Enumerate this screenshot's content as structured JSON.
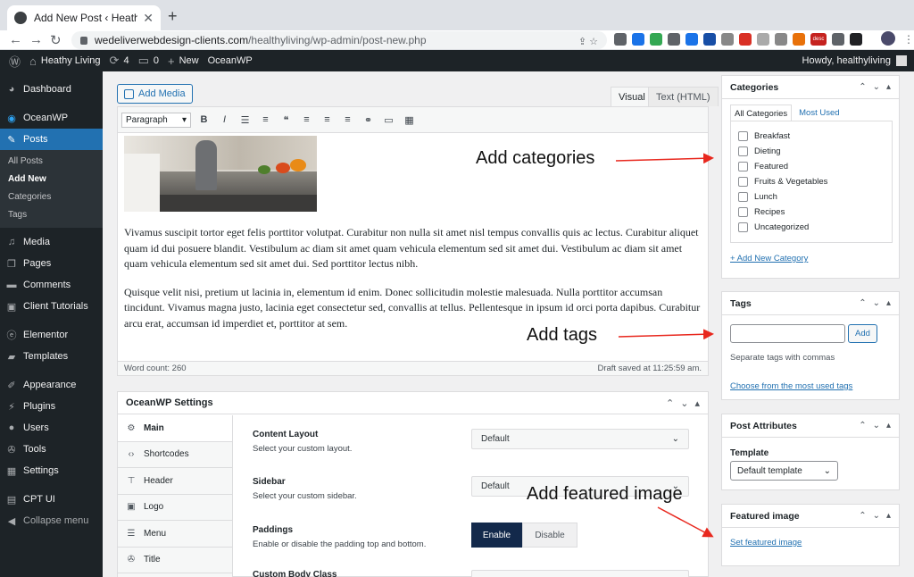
{
  "browser": {
    "tab_title": "Add New Post ‹ Heathy Living",
    "tab_close": "✕",
    "new_tab": "+",
    "url_host": "wedeliverwebdesign-clients.com",
    "url_path": "/healthyliving/wp-admin/post-new.php",
    "ext_badge": "desc"
  },
  "adminbar": {
    "site_name": "Heathy Living",
    "updates_count": "4",
    "comments_count": "0",
    "new_label": "New",
    "theme_label": "OceanWP",
    "howdy": "Howdy, healthyliving"
  },
  "sidebar": {
    "items": [
      {
        "label": "Dashboard",
        "icon": "dashboard-icon"
      },
      {
        "label": "OceanWP",
        "icon": "oceanwp-icon"
      },
      {
        "label": "Posts",
        "icon": "pin-icon"
      },
      {
        "label": "Media",
        "icon": "media-icon"
      },
      {
        "label": "Pages",
        "icon": "pages-icon"
      },
      {
        "label": "Comments",
        "icon": "comments-icon"
      },
      {
        "label": "Client Tutorials",
        "icon": "tutorials-icon"
      },
      {
        "label": "Elementor",
        "icon": "elementor-icon"
      },
      {
        "label": "Templates",
        "icon": "folder-icon"
      },
      {
        "label": "Appearance",
        "icon": "brush-icon"
      },
      {
        "label": "Plugins",
        "icon": "plugin-icon"
      },
      {
        "label": "Users",
        "icon": "users-icon"
      },
      {
        "label": "Tools",
        "icon": "wrench-icon"
      },
      {
        "label": "Settings",
        "icon": "settings-icon"
      },
      {
        "label": "CPT UI",
        "icon": "cptui-icon"
      },
      {
        "label": "Collapse menu",
        "icon": "collapse-icon"
      }
    ],
    "posts_sub": [
      "All Posts",
      "Add New",
      "Categories",
      "Tags"
    ]
  },
  "editor": {
    "add_media": "Add Media",
    "tab_visual": "Visual",
    "tab_text": "Text (HTML)",
    "format": "Paragraph",
    "paragraph1": "Vivamus suscipit tortor eget felis porttitor volutpat. Curabitur non nulla sit amet nisl tempus convallis quis ac lectus. Curabitur aliquet quam id dui posuere blandit. Vestibulum ac diam sit amet quam vehicula elementum sed sit amet dui. Vestibulum ac diam sit amet quam vehicula elementum sed sit amet dui. Sed porttitor lectus nibh.",
    "paragraph2": "Quisque velit nisi, pretium ut lacinia in, elementum id enim. Donec sollicitudin molestie malesuada. Nulla porttitor accumsan tincidunt. Vivamus magna justo, lacinia eget consectetur sed, convallis at tellus. Pellentesque in ipsum id orci porta dapibus. Curabitur arcu erat, accumsan id imperdiet et, porttitor at sem.",
    "word_count": "Word count: 260",
    "draft_saved": "Draft saved at 11:25:59 am."
  },
  "oceanwp": {
    "title": "OceanWP Settings",
    "tabs": [
      {
        "label": "Main",
        "icon": "gear-icon"
      },
      {
        "label": "Shortcodes",
        "icon": "code-icon"
      },
      {
        "label": "Header",
        "icon": "pin-icon"
      },
      {
        "label": "Logo",
        "icon": "image-icon"
      },
      {
        "label": "Menu",
        "icon": "menu-icon"
      },
      {
        "label": "Title",
        "icon": "wrench-icon"
      }
    ],
    "content_layout": {
      "label": "Content Layout",
      "desc": "Select your custom layout.",
      "value": "Default"
    },
    "sidebar": {
      "label": "Sidebar",
      "desc": "Select your custom sidebar.",
      "value": "Default"
    },
    "paddings": {
      "label": "Paddings",
      "desc": "Enable or disable the padding top and bottom.",
      "enable": "Enable",
      "disable": "Disable"
    },
    "custom_body_class": {
      "label": "Custom Body Class"
    }
  },
  "categories": {
    "title": "Categories",
    "tab_all": "All Categories",
    "tab_most": "Most Used",
    "items": [
      "Breakfast",
      "Dieting",
      "Featured",
      "Fruits & Vegetables",
      "Lunch",
      "Recipes",
      "Uncategorized"
    ],
    "add_new": "+ Add New Category"
  },
  "tags": {
    "title": "Tags",
    "add": "Add",
    "hint": "Separate tags with commas",
    "choose": "Choose from the most used tags"
  },
  "post_attributes": {
    "title": "Post Attributes",
    "template_label": "Template",
    "template_value": "Default template"
  },
  "featured_image": {
    "title": "Featured image",
    "set": "Set featured image"
  },
  "annotations": {
    "categories": "Add categories",
    "tags": "Add tags",
    "featured": "Add featured image",
    "color": "#e8281e"
  }
}
